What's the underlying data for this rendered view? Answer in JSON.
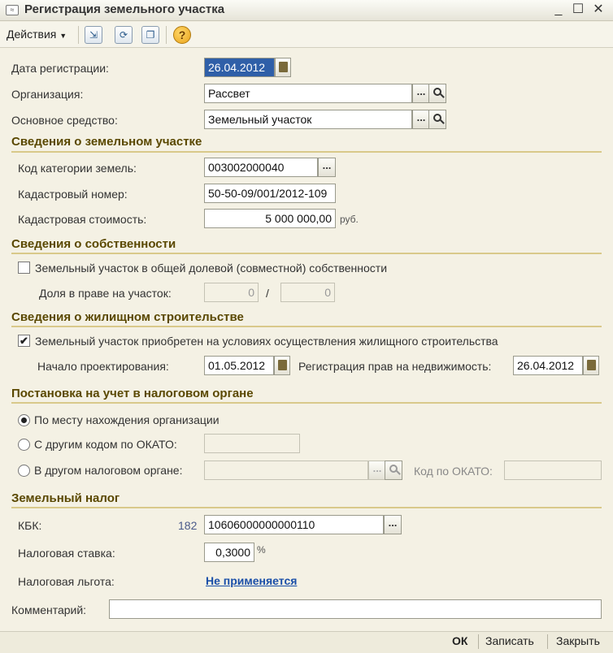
{
  "window": {
    "title": "Регистрация земельного участка",
    "controls": [
      "_",
      "☐",
      "✕"
    ]
  },
  "toolbar": {
    "actions_label": "Действия",
    "help_glyph": "?"
  },
  "form": {
    "reg_date_label": "Дата регистрации:",
    "reg_date_value": "26.04.2012",
    "org_label": "Организация:",
    "org_value": "Рассвет",
    "asset_label": "Основное средство:",
    "asset_value": "Земельный участок"
  },
  "land": {
    "section_title": "Сведения о земельном участке",
    "category_label": "Код категории земель:",
    "category_value": "003002000040",
    "cadastral_no_label": "Кадастровый номер:",
    "cadastral_no_value": "50-50-09/001/2012-109",
    "cadastral_cost_label": "Кадастровая стоимость:",
    "cadastral_cost_value": "5 000 000,00",
    "currency": "руб."
  },
  "ownership": {
    "section_title": "Сведения о собственности",
    "shared_label": "Земельный участок в общей долевой (совместной) собственности",
    "share_label": "Доля в праве на участок:",
    "share_num": "0",
    "share_sep": "/",
    "share_den": "0"
  },
  "housing": {
    "section_title": "Сведения о жилищном строительстве",
    "acquired_label": "Земельный участок приобретен на условиях осуществления жилищного строительства",
    "acquired_checked": "✔",
    "design_start_label": "Начало проектирования:",
    "design_start_value": "01.05.2012",
    "rights_reg_label": "Регистрация прав на недвижимость:",
    "rights_reg_value": "26.04.2012"
  },
  "tax_reg": {
    "section_title": "Постановка на учет в налоговом органе",
    "opt_org_location": "По месту нахождения организации",
    "opt_other_okato": "С другим кодом по ОКАТО:",
    "opt_other_authority": "В другом налоговом органе:",
    "okato_code_label": "Код по ОКАТО:"
  },
  "land_tax": {
    "section_title": "Земельный налог",
    "kbk_label": "КБК:",
    "kbk_prefix": "182",
    "kbk_value": "10606000000000110",
    "rate_label": "Налоговая ставка:",
    "rate_value": "0,3000",
    "rate_unit": "%",
    "benefit_label": "Налоговая льгота:",
    "benefit_value": "Не применяется"
  },
  "comment": {
    "label": "Комментарий:",
    "value": ""
  },
  "footer": {
    "ok_label": "ОК",
    "save_label": "Записать",
    "close_label": "Закрыть"
  }
}
